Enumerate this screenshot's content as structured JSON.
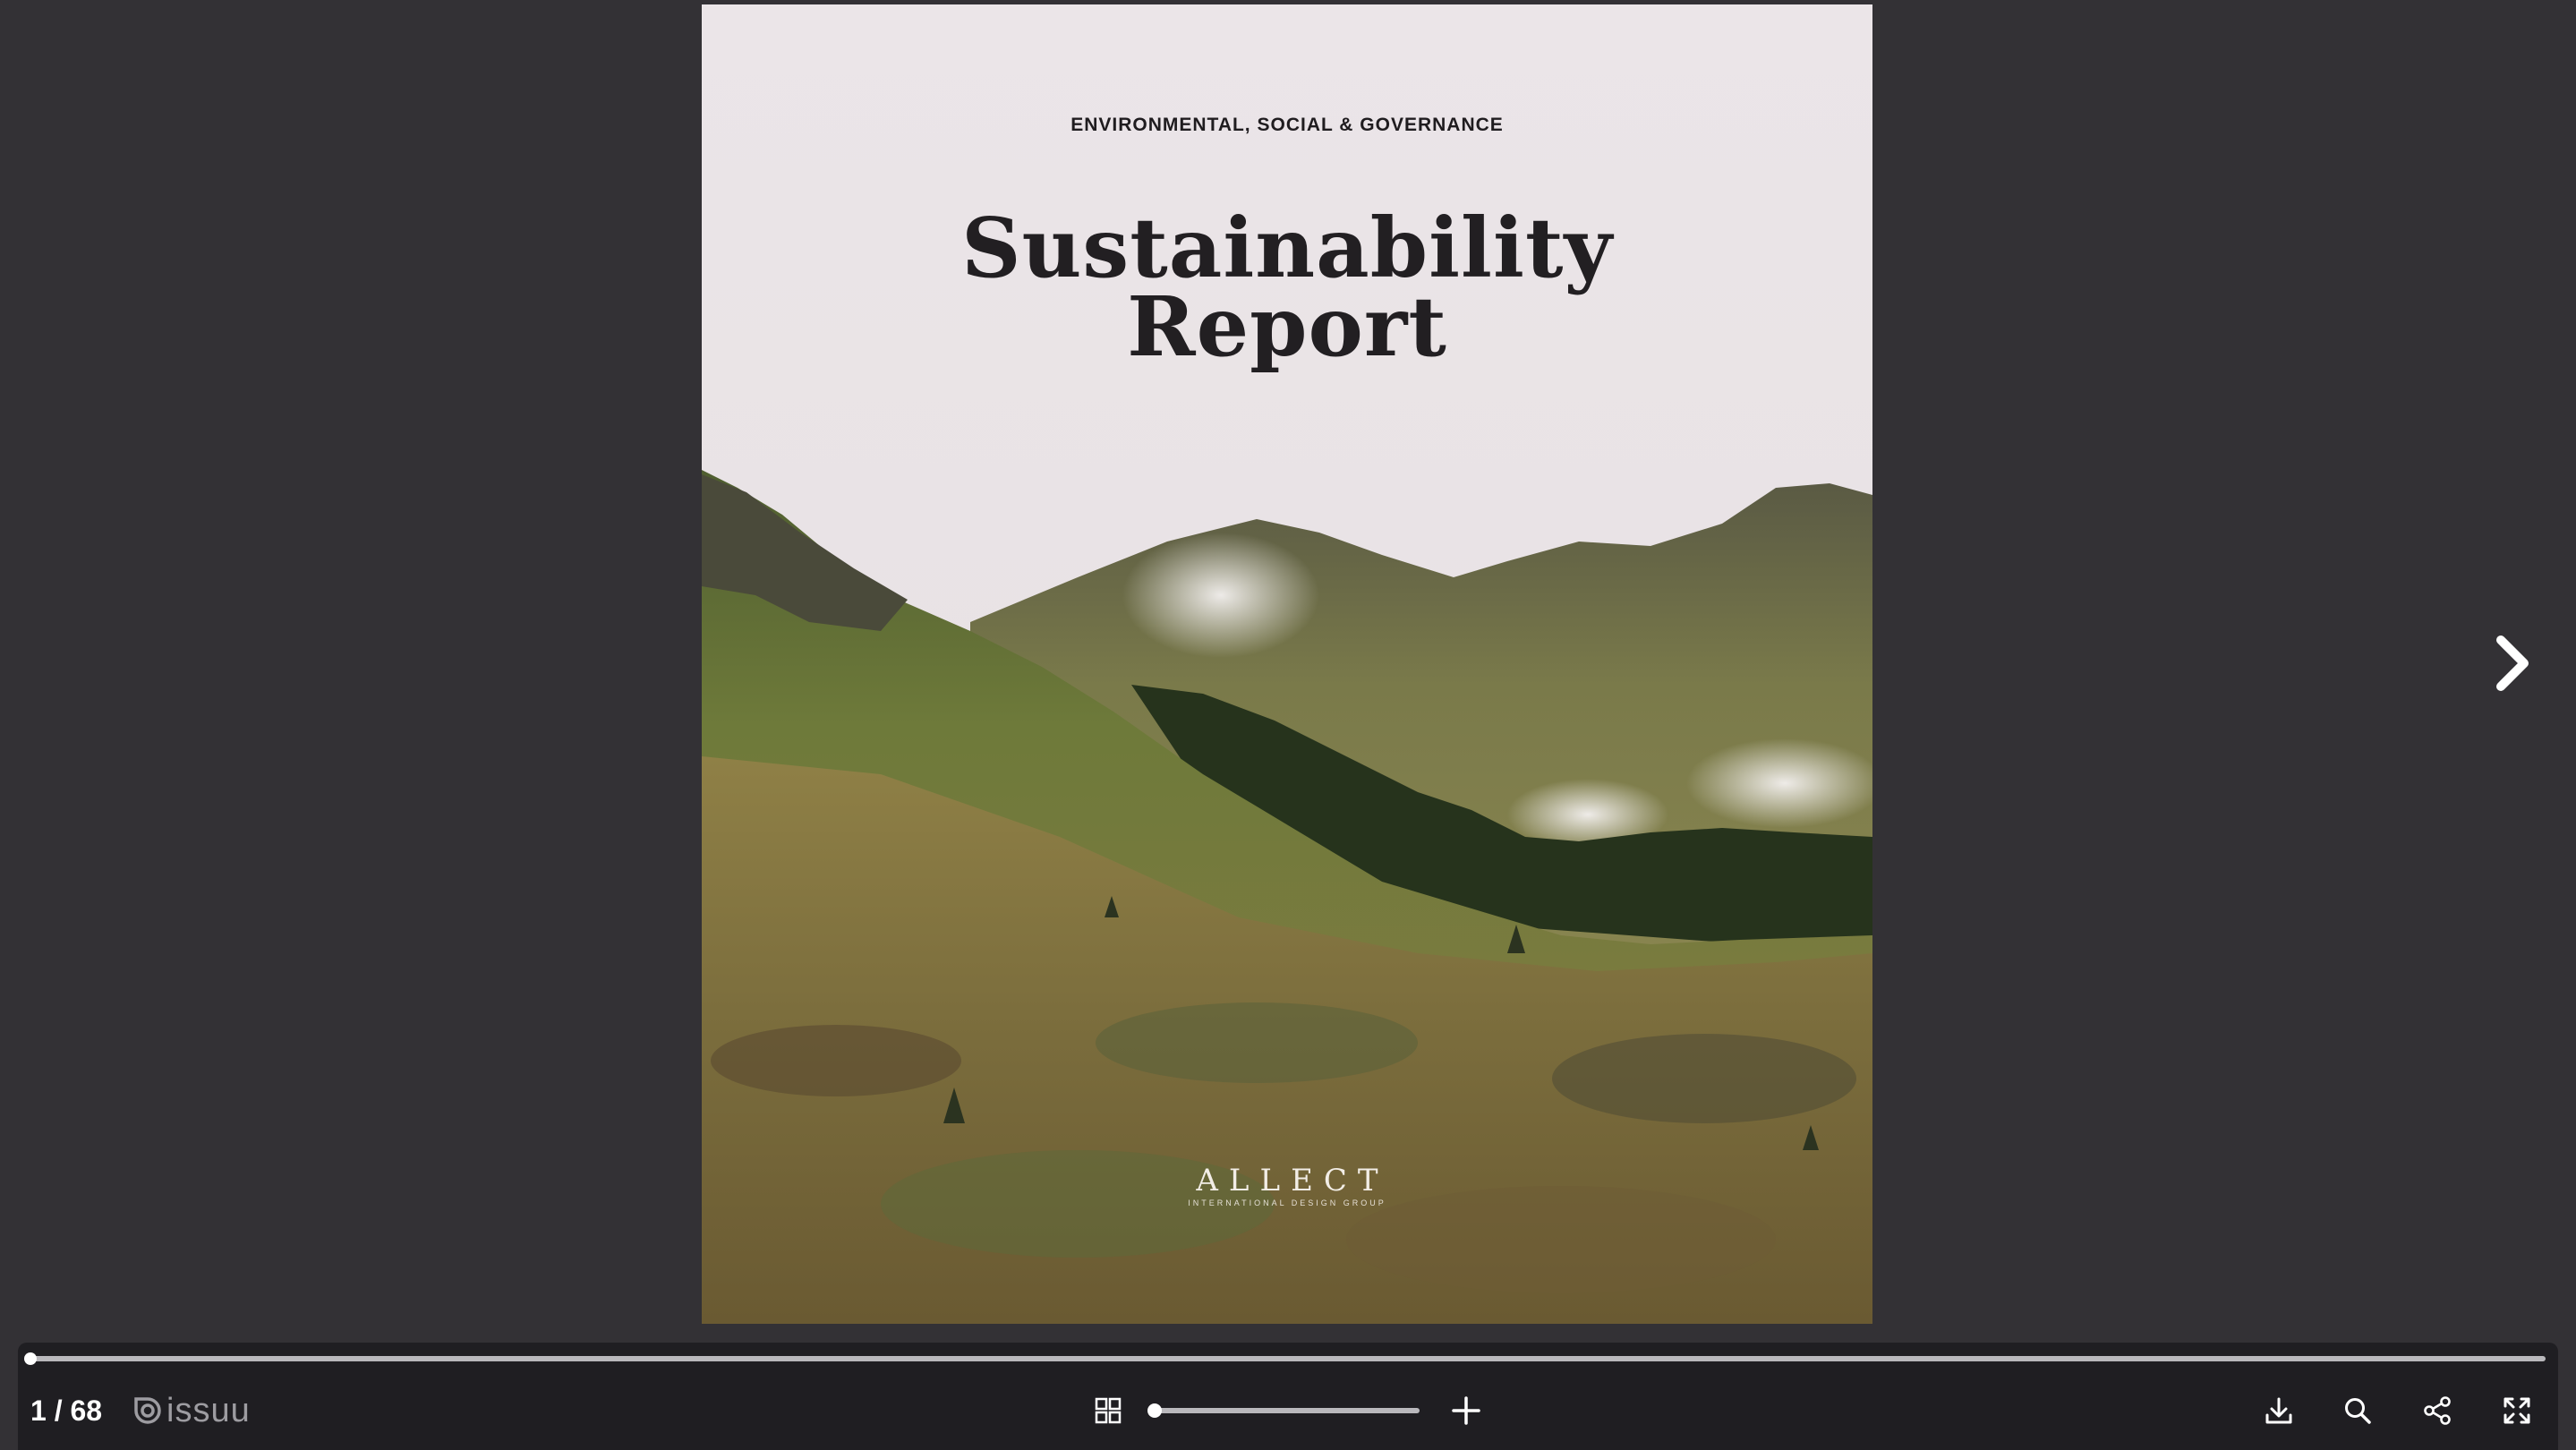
{
  "cover": {
    "kicker": "ENVIRONMENTAL, SOCIAL & GOVERNANCE",
    "title_line1": "Sustainability",
    "title_line2": "Report",
    "brand_name": "ALLECT",
    "brand_tagline": "INTERNATIONAL DESIGN GROUP"
  },
  "navigation": {
    "next_icon": "chevron-right-icon"
  },
  "toolbar": {
    "current_page": 1,
    "total_pages": 68,
    "page_counter": "1 / 68",
    "logo_text": "issuu",
    "zoom_level": 0,
    "icons": {
      "grid": "grid-view-icon",
      "zoom_in": "plus-icon",
      "download": "download-icon",
      "search": "search-icon",
      "share": "share-icon",
      "fullscreen": "fullscreen-icon"
    }
  },
  "colors": {
    "background": "#333135",
    "toolbar": "#1f1e22",
    "sky": "#e9e3e6",
    "title_text": "#221f22",
    "logo_gray": "#9d9ca1"
  }
}
